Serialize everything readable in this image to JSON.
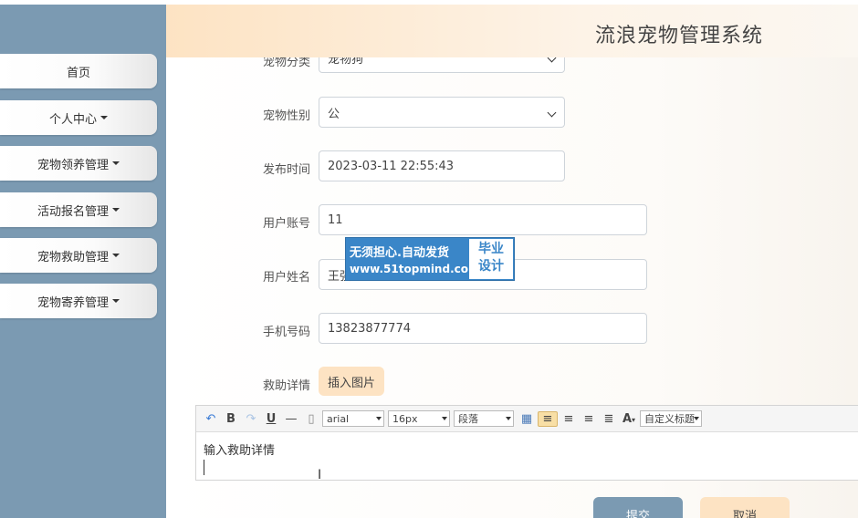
{
  "header": {
    "title": "流浪宠物管理系统"
  },
  "sidebar": {
    "items": [
      {
        "label": "首页"
      },
      {
        "label": "个人中心"
      },
      {
        "label": "宠物领养管理"
      },
      {
        "label": "活动报名管理"
      },
      {
        "label": "宠物救助管理"
      },
      {
        "label": "宠物寄养管理"
      }
    ]
  },
  "form": {
    "pet_type": {
      "label": "宠物分类",
      "value": "宠物狗"
    },
    "pet_gender": {
      "label": "宠物性别",
      "value": "公"
    },
    "publish_time": {
      "label": "发布时间",
      "value": "2023-03-11 22:55:43"
    },
    "user_account": {
      "label": "用户账号",
      "value": "11"
    },
    "user_name": {
      "label": "用户姓名",
      "value": "王强"
    },
    "phone": {
      "label": "手机号码",
      "value": "13823877774"
    },
    "rescue_detail": {
      "label": "救助详情",
      "insert_image_label": "插入图片"
    }
  },
  "editor": {
    "font": "arial",
    "size": "16px",
    "paragraph": "段落",
    "custom_heading": "自定义标题",
    "content": "输入救助详情"
  },
  "actions": {
    "submit": "提交",
    "cancel": "取消"
  },
  "watermark": {
    "line1": "无须担心.自动发货",
    "line2": "www.51topmind.com",
    "badge1": "毕业",
    "badge2": "设计"
  },
  "colors": {
    "sidebar": "#7b9ab2",
    "accent": "#fde3c3"
  }
}
